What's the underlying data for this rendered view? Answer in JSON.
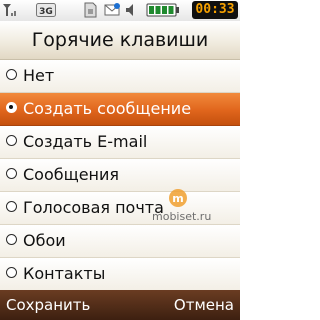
{
  "status": {
    "time": "00:33",
    "icons": [
      "signal-strength-icon",
      "3g-icon",
      "sim-card-icon",
      "message-icon",
      "volume-icon",
      "battery-icon"
    ]
  },
  "header": {
    "title": "Горячие клавиши"
  },
  "menu": {
    "selected_index": 1,
    "items": [
      {
        "label": "Нет"
      },
      {
        "label": "Создать сообщение"
      },
      {
        "label": "Создать E-mail"
      },
      {
        "label": "Сообщения"
      },
      {
        "label": "Голосовая почта"
      },
      {
        "label": "Обои"
      },
      {
        "label": "Контакты"
      }
    ]
  },
  "watermark": {
    "text": "mobiset.ru"
  },
  "softkeys": {
    "left": "Сохранить",
    "right": "Отмена"
  },
  "colors": {
    "highlight": "#e0651c",
    "softkey_bar": "#4a2815",
    "clock_text": "#f5a000",
    "battery": "#1f8a2e"
  }
}
